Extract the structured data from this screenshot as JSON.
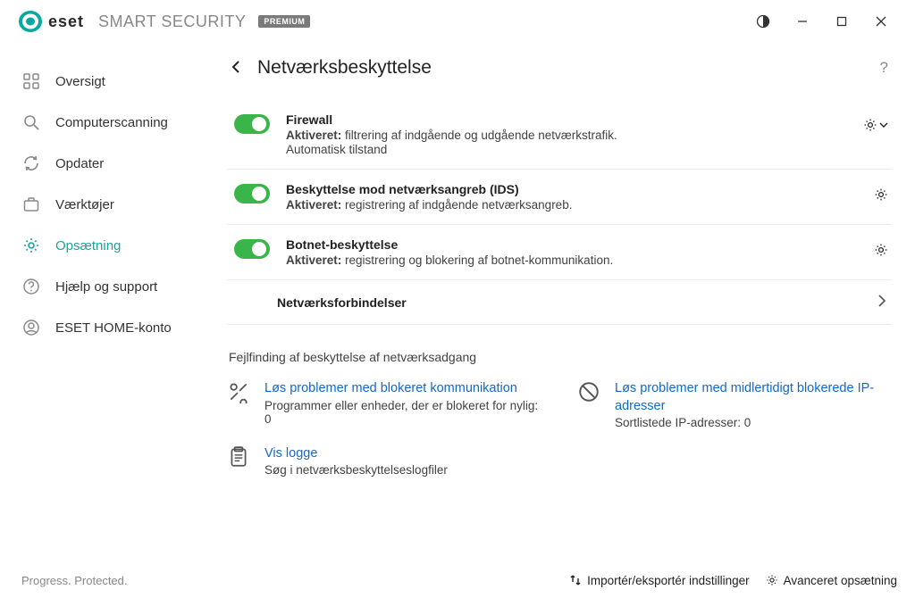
{
  "brand": {
    "eset": "eset",
    "product": "SMART SECURITY",
    "badge": "PREMIUM"
  },
  "sidebar": {
    "items": [
      {
        "label": "Oversigt"
      },
      {
        "label": "Computerscanning"
      },
      {
        "label": "Opdater"
      },
      {
        "label": "Værktøjer"
      },
      {
        "label": "Opsætning"
      },
      {
        "label": "Hjælp og support"
      },
      {
        "label": "ESET HOME-konto"
      }
    ]
  },
  "page": {
    "title": "Netværksbeskyttelse",
    "settings": [
      {
        "title": "Firewall",
        "status": "Aktiveret:",
        "desc": "filtrering af indgående og udgående netværkstrafik.",
        "extra": "Automatisk tilstand"
      },
      {
        "title": "Beskyttelse mod netværksangreb (IDS)",
        "status": "Aktiveret:",
        "desc": "registrering af indgående netværksangreb."
      },
      {
        "title": "Botnet-beskyttelse",
        "status": "Aktiveret:",
        "desc": "registrering og blokering af botnet-kommunikation."
      }
    ],
    "connections_label": "Netværksforbindelser",
    "troubleshoot_heading": "Fejlfinding af beskyttelse af netværksadgang",
    "trouble": {
      "blocked_comm": {
        "title": "Løs problemer med blokeret kommunikation",
        "desc": "Programmer eller enheder, der er blokeret for nylig: 0"
      },
      "blocked_ips": {
        "title": "Løs problemer med midlertidigt blokerede IP-adresser",
        "desc": "Sortlistede IP-adresser: 0"
      },
      "logs": {
        "title": "Vis logge",
        "desc": "Søg i netværksbeskyttelseslogfiler"
      }
    }
  },
  "footer": {
    "tagline": "Progress. Protected.",
    "import_export": "Importér/eksportér indstillinger",
    "advanced": "Avanceret opsætning"
  }
}
